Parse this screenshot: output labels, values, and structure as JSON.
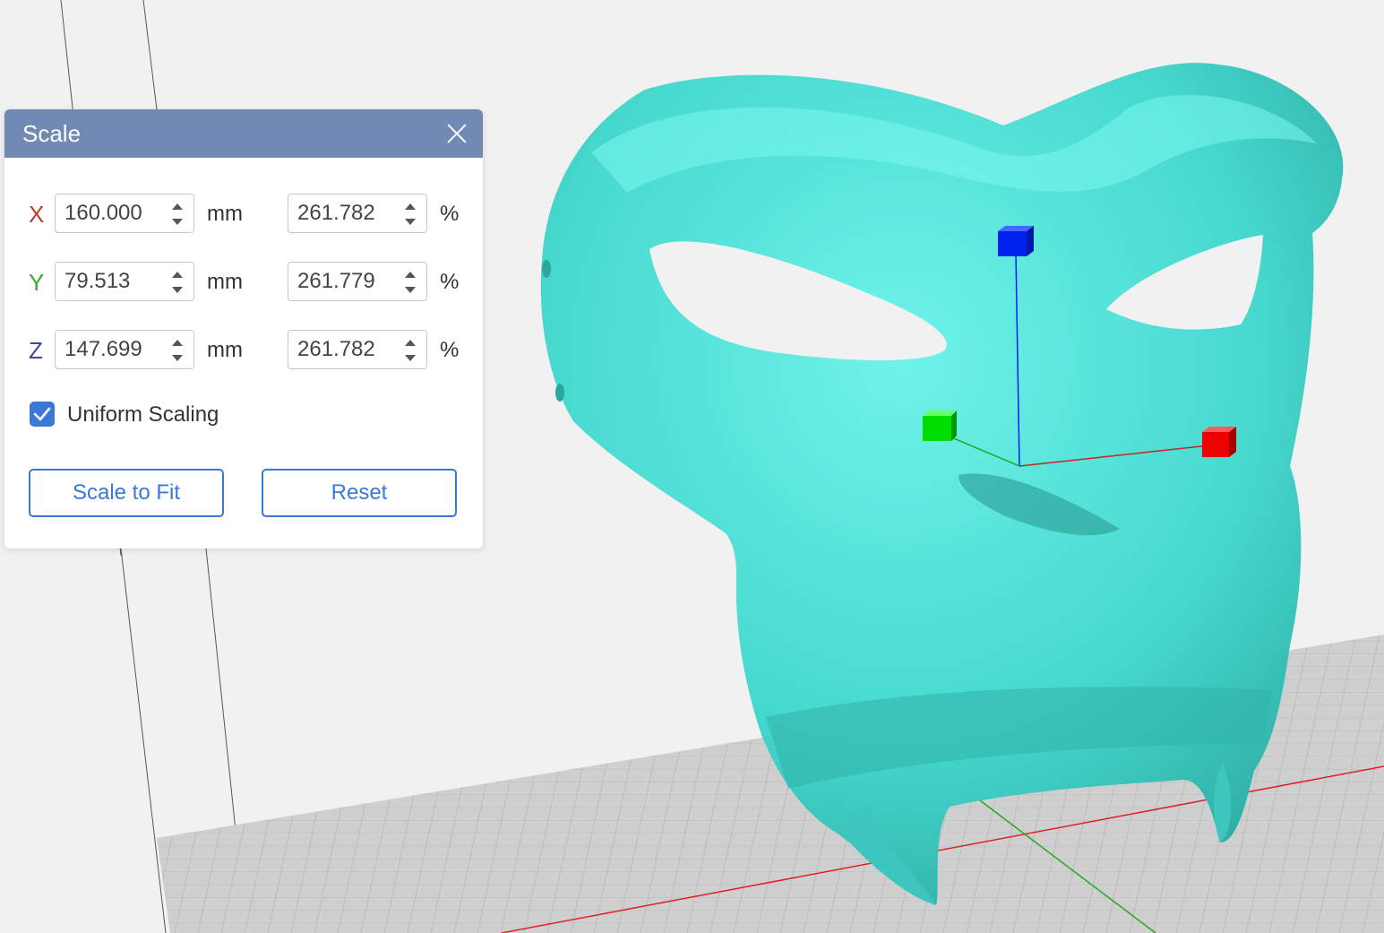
{
  "dialog": {
    "title": "Scale",
    "rows": [
      {
        "axis": "X",
        "axis_color": "#c0392b",
        "mm": "160.000",
        "mm_unit": "mm",
        "percent": "261.782",
        "percent_unit": "%"
      },
      {
        "axis": "Y",
        "axis_color": "#3aa832",
        "mm": "79.513",
        "mm_unit": "mm",
        "percent": "261.779",
        "percent_unit": "%"
      },
      {
        "axis": "Z",
        "axis_color": "#3b4a9c",
        "mm": "147.699",
        "mm_unit": "mm",
        "percent": "261.782",
        "percent_unit": "%"
      }
    ],
    "uniform_scaling": {
      "label": "Uniform Scaling",
      "checked": true
    },
    "scale_to_fit_label": "Scale to Fit",
    "reset_label": "Reset"
  },
  "viewport": {
    "model_color": "#47d9cf",
    "bed_color": "#c8c8c8",
    "gizmo_colors": {
      "x": "#ff0000",
      "y": "#00d000",
      "z": "#0022ee"
    }
  }
}
